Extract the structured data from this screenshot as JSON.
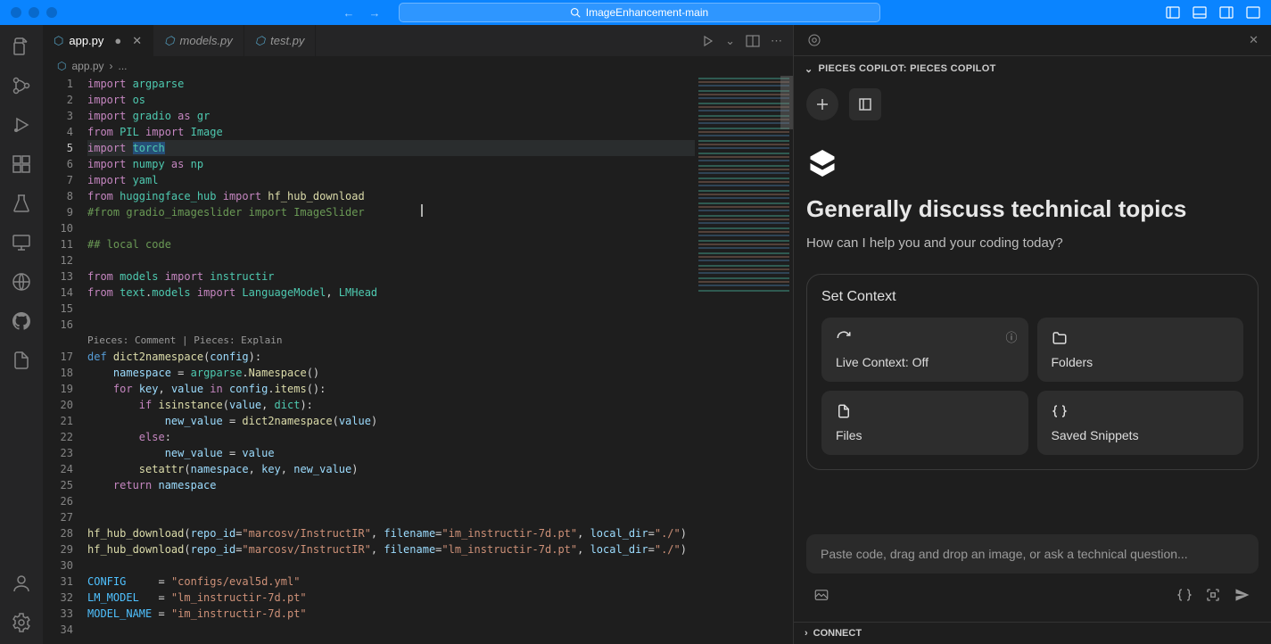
{
  "titlebar": {
    "project": "ImageEnhancement-main"
  },
  "tabs": [
    {
      "name": "app.py",
      "active": true,
      "dirty": true
    },
    {
      "name": "models.py",
      "active": false,
      "dirty": false
    },
    {
      "name": "test.py",
      "active": false,
      "dirty": false
    }
  ],
  "breadcrumb": {
    "file": "app.py",
    "more": "..."
  },
  "editor": {
    "hint": "Pieces: Comment | Pieces: Explain",
    "lines": [
      {
        "n": 1,
        "tokens": [
          [
            "import ",
            "kw"
          ],
          [
            "argparse",
            "mod"
          ]
        ]
      },
      {
        "n": 2,
        "tokens": [
          [
            "import ",
            "kw"
          ],
          [
            "os",
            "mod"
          ]
        ]
      },
      {
        "n": 3,
        "tokens": [
          [
            "import ",
            "kw"
          ],
          [
            "gradio",
            "mod"
          ],
          [
            " as ",
            "kw"
          ],
          [
            "gr",
            "mod"
          ]
        ]
      },
      {
        "n": 4,
        "tokens": [
          [
            "from ",
            "kw"
          ],
          [
            "PIL",
            "mod"
          ],
          [
            " import ",
            "kw"
          ],
          [
            "Image",
            "mod"
          ]
        ]
      },
      {
        "n": 5,
        "hl": true,
        "tokens": [
          [
            "import ",
            "kw"
          ],
          [
            "torch",
            "mod",
            "sel"
          ]
        ]
      },
      {
        "n": 6,
        "tokens": [
          [
            "import ",
            "kw"
          ],
          [
            "numpy",
            "mod"
          ],
          [
            " as ",
            "kw"
          ],
          [
            "np",
            "mod"
          ]
        ]
      },
      {
        "n": 7,
        "tokens": [
          [
            "import ",
            "kw"
          ],
          [
            "yaml",
            "mod"
          ]
        ]
      },
      {
        "n": 8,
        "tokens": [
          [
            "from ",
            "kw"
          ],
          [
            "huggingface_hub",
            "mod"
          ],
          [
            " import ",
            "kw"
          ],
          [
            "hf_hub_download",
            "fn"
          ]
        ]
      },
      {
        "n": 9,
        "tokens": [
          [
            "#from gradio_imageslider import ImageSlider",
            "cm"
          ]
        ]
      },
      {
        "n": 10,
        "tokens": []
      },
      {
        "n": 11,
        "tokens": [
          [
            "## local code",
            "cm"
          ]
        ]
      },
      {
        "n": 12,
        "tokens": []
      },
      {
        "n": 13,
        "tokens": [
          [
            "from ",
            "kw"
          ],
          [
            "models",
            "mod"
          ],
          [
            " import ",
            "kw"
          ],
          [
            "instructir",
            "mod"
          ]
        ]
      },
      {
        "n": 14,
        "tokens": [
          [
            "from ",
            "kw"
          ],
          [
            "text",
            "mod"
          ],
          [
            ".",
            "op"
          ],
          [
            "models",
            "mod"
          ],
          [
            " import ",
            "kw"
          ],
          [
            "LanguageModel",
            "mod"
          ],
          [
            ", ",
            "op"
          ],
          [
            "LMHead",
            "mod"
          ]
        ]
      },
      {
        "n": 15,
        "tokens": []
      },
      {
        "n": 16,
        "tokens": []
      },
      {
        "n": 17,
        "codelens": true,
        "tokens": [
          [
            "def ",
            "def"
          ],
          [
            "dict2namespace",
            "fn"
          ],
          [
            "(",
            "op"
          ],
          [
            "config",
            "var"
          ],
          [
            "):",
            "op"
          ]
        ]
      },
      {
        "n": 18,
        "tokens": [
          [
            "    ",
            "op"
          ],
          [
            "namespace",
            "var"
          ],
          [
            " = ",
            "op"
          ],
          [
            "argparse",
            "mod"
          ],
          [
            ".",
            "op"
          ],
          [
            "Namespace",
            "fn"
          ],
          [
            "()",
            "op"
          ]
        ]
      },
      {
        "n": 19,
        "tokens": [
          [
            "    ",
            "op"
          ],
          [
            "for ",
            "kw"
          ],
          [
            "key",
            "var"
          ],
          [
            ", ",
            "op"
          ],
          [
            "value",
            "var"
          ],
          [
            " in ",
            "kw"
          ],
          [
            "config",
            "var"
          ],
          [
            ".",
            "op"
          ],
          [
            "items",
            "fn"
          ],
          [
            "():",
            "op"
          ]
        ]
      },
      {
        "n": 20,
        "tokens": [
          [
            "        ",
            "op"
          ],
          [
            "if ",
            "kw"
          ],
          [
            "isinstance",
            "fn"
          ],
          [
            "(",
            "op"
          ],
          [
            "value",
            "var"
          ],
          [
            ", ",
            "op"
          ],
          [
            "dict",
            "mod"
          ],
          [
            "):",
            "op"
          ]
        ]
      },
      {
        "n": 21,
        "tokens": [
          [
            "            ",
            "op"
          ],
          [
            "new_value",
            "var"
          ],
          [
            " = ",
            "op"
          ],
          [
            "dict2namespace",
            "fn"
          ],
          [
            "(",
            "op"
          ],
          [
            "value",
            "var"
          ],
          [
            ")",
            "op"
          ]
        ]
      },
      {
        "n": 22,
        "tokens": [
          [
            "        ",
            "op"
          ],
          [
            "else",
            "kw"
          ],
          [
            ":",
            "op"
          ]
        ]
      },
      {
        "n": 23,
        "tokens": [
          [
            "            ",
            "op"
          ],
          [
            "new_value",
            "var"
          ],
          [
            " = ",
            "op"
          ],
          [
            "value",
            "var"
          ]
        ]
      },
      {
        "n": 24,
        "tokens": [
          [
            "        ",
            "op"
          ],
          [
            "setattr",
            "fn"
          ],
          [
            "(",
            "op"
          ],
          [
            "namespace",
            "var"
          ],
          [
            ", ",
            "op"
          ],
          [
            "key",
            "var"
          ],
          [
            ", ",
            "op"
          ],
          [
            "new_value",
            "var"
          ],
          [
            ")",
            "op"
          ]
        ]
      },
      {
        "n": 25,
        "tokens": [
          [
            "    ",
            "op"
          ],
          [
            "return ",
            "kw"
          ],
          [
            "namespace",
            "var"
          ]
        ]
      },
      {
        "n": 26,
        "tokens": []
      },
      {
        "n": 27,
        "tokens": []
      },
      {
        "n": 28,
        "tokens": [
          [
            "hf_hub_download",
            "fn"
          ],
          [
            "(",
            "op"
          ],
          [
            "repo_id",
            "var"
          ],
          [
            "=",
            "op"
          ],
          [
            "\"marcosv/InstructIR\"",
            "str"
          ],
          [
            ", ",
            "op"
          ],
          [
            "filename",
            "var"
          ],
          [
            "=",
            "op"
          ],
          [
            "\"im_instructir-7d.pt\"",
            "str"
          ],
          [
            ", ",
            "op"
          ],
          [
            "local_dir",
            "var"
          ],
          [
            "=",
            "op"
          ],
          [
            "\"./\"",
            "str"
          ],
          [
            ")",
            "op"
          ]
        ]
      },
      {
        "n": 29,
        "tokens": [
          [
            "hf_hub_download",
            "fn"
          ],
          [
            "(",
            "op"
          ],
          [
            "repo_id",
            "var"
          ],
          [
            "=",
            "op"
          ],
          [
            "\"marcosv/InstructIR\"",
            "str"
          ],
          [
            ", ",
            "op"
          ],
          [
            "filename",
            "var"
          ],
          [
            "=",
            "op"
          ],
          [
            "\"lm_instructir-7d.pt\"",
            "str"
          ],
          [
            ", ",
            "op"
          ],
          [
            "local_dir",
            "var"
          ],
          [
            "=",
            "op"
          ],
          [
            "\"./\"",
            "str"
          ],
          [
            ")",
            "op"
          ]
        ]
      },
      {
        "n": 30,
        "tokens": []
      },
      {
        "n": 31,
        "tokens": [
          [
            "CONFIG",
            "const"
          ],
          [
            "     = ",
            "op"
          ],
          [
            "\"configs/eval5d.yml\"",
            "str"
          ]
        ]
      },
      {
        "n": 32,
        "tokens": [
          [
            "LM_MODEL",
            "const"
          ],
          [
            "   = ",
            "op"
          ],
          [
            "\"lm_instructir-7d.pt\"",
            "str"
          ]
        ]
      },
      {
        "n": 33,
        "tokens": [
          [
            "MODEL_NAME",
            "const"
          ],
          [
            " = ",
            "op"
          ],
          [
            "\"im_instructir-7d.pt\"",
            "str"
          ]
        ]
      },
      {
        "n": 34,
        "tokens": []
      }
    ]
  },
  "copilot": {
    "header": "PIECES COPILOT: PIECES COPILOT",
    "heading": "Generally discuss technical topics",
    "sub": "How can I help you and your coding today?",
    "contextTitle": "Set Context",
    "tiles": {
      "liveContext": "Live Context: Off",
      "folders": "Folders",
      "files": "Files",
      "snippets": "Saved Snippets"
    },
    "placeholder": "Paste code, drag and drop an image, or ask a technical question...",
    "connect": "CONNECT"
  }
}
